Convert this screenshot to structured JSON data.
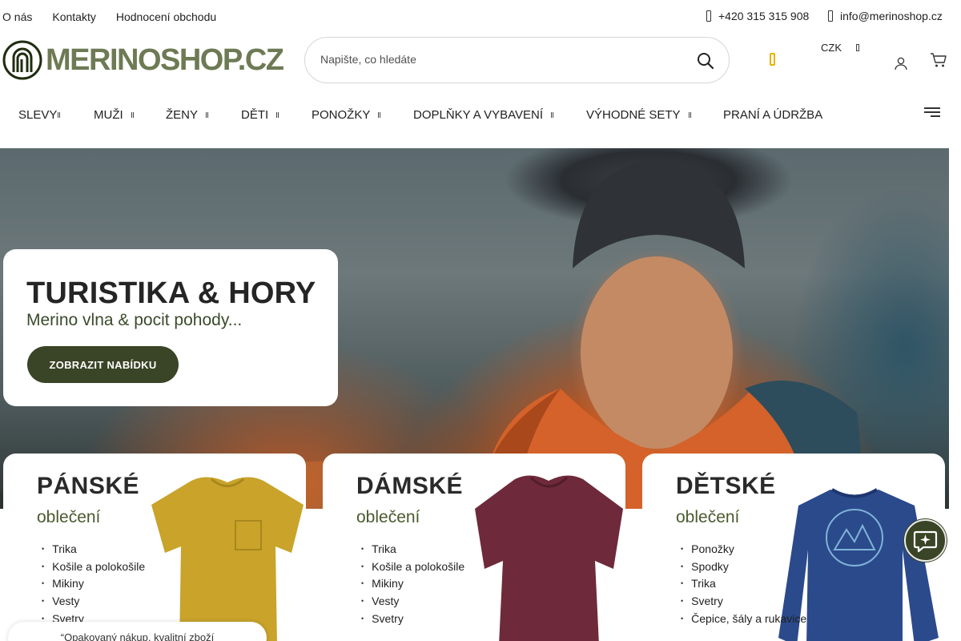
{
  "topbar": {
    "links": [
      "O nás",
      "Kontakty",
      "Hodnocení obchodu"
    ],
    "phone": "+420 315 315 908",
    "email": "info@merinoshop.cz"
  },
  "header": {
    "logo_text": "MERINOSHOP.CZ",
    "search_placeholder": "Napište, co hledáte",
    "currency": "CZK"
  },
  "nav": {
    "items": [
      "SLEVY",
      "MUŽI",
      "ŽENY",
      "DĚTI",
      "PONOŽKY",
      "DOPLŇKY A VYBAVENÍ",
      "VÝHODNÉ SETY",
      "PRANÍ A ÚDRŽBA"
    ]
  },
  "hero": {
    "title": "TURISTIKA & HORY",
    "subtitle": "Merino vlna & pocit pohody...",
    "button": "ZOBRAZIT NABÍDKU"
  },
  "categories": [
    {
      "title": "PÁNSKÉ",
      "subtitle": "oblečení",
      "items": [
        "Trika",
        "Košile a polokošile",
        "Mikiny",
        "Vesty",
        "Svetry"
      ]
    },
    {
      "title": "DÁMSKÉ",
      "subtitle": "oblečení",
      "items": [
        "Trika",
        "Košile a polokošile",
        "Mikiny",
        "Vesty",
        "Svetry"
      ]
    },
    {
      "title": "DĚTSKÉ",
      "subtitle": "oblečení",
      "items": [
        "Ponožky",
        "Spodky",
        "Trika",
        "Svetry",
        "Čepice, šály a rukavice"
      ]
    }
  ],
  "testimonial": "“Opakovaný nákup, kvalitní zboží",
  "colors": {
    "brand": "#3a4426",
    "logo": "#6d7a54",
    "accent": "#e8b200",
    "hero_jacket": "#d9692a"
  }
}
